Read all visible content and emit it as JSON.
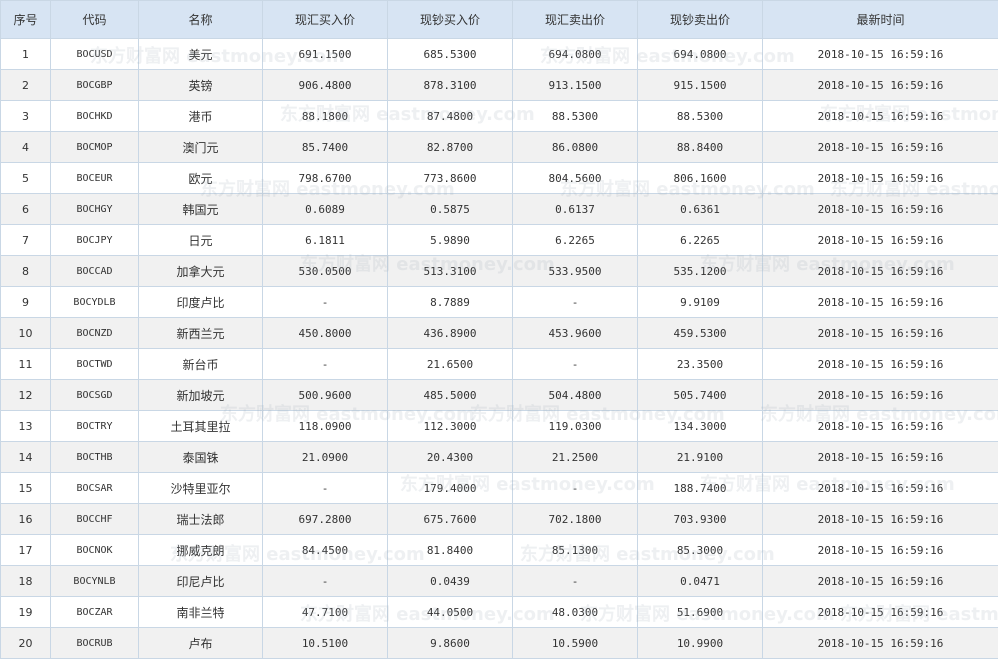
{
  "headers": [
    "序号",
    "代码",
    "名称",
    "现汇买入价",
    "现钞买入价",
    "现汇卖出价",
    "现钞卖出价",
    "最新时间"
  ],
  "rows": [
    [
      "1",
      "BOCUSD",
      "美元",
      "691.1500",
      "685.5300",
      "694.0800",
      "694.0800",
      "2018-10-15 16:59:16"
    ],
    [
      "2",
      "BOCGBP",
      "英镑",
      "906.4800",
      "878.3100",
      "913.1500",
      "915.1500",
      "2018-10-15 16:59:16"
    ],
    [
      "3",
      "BOCHKD",
      "港币",
      "88.1800",
      "87.4800",
      "88.5300",
      "88.5300",
      "2018-10-15 16:59:16"
    ],
    [
      "4",
      "BOCMOP",
      "澳门元",
      "85.7400",
      "82.8700",
      "86.0800",
      "88.8400",
      "2018-10-15 16:59:16"
    ],
    [
      "5",
      "BOCEUR",
      "欧元",
      "798.6700",
      "773.8600",
      "804.5600",
      "806.1600",
      "2018-10-15 16:59:16"
    ],
    [
      "6",
      "BOCHGY",
      "韩国元",
      "0.6089",
      "0.5875",
      "0.6137",
      "0.6361",
      "2018-10-15 16:59:16"
    ],
    [
      "7",
      "BOCJPY",
      "日元",
      "6.1811",
      "5.9890",
      "6.2265",
      "6.2265",
      "2018-10-15 16:59:16"
    ],
    [
      "8",
      "BOCCAD",
      "加拿大元",
      "530.0500",
      "513.3100",
      "533.9500",
      "535.1200",
      "2018-10-15 16:59:16"
    ],
    [
      "9",
      "BOCYDLB",
      "印度卢比",
      "-",
      "8.7889",
      "-",
      "9.9109",
      "2018-10-15 16:59:16"
    ],
    [
      "10",
      "BOCNZD",
      "新西兰元",
      "450.8000",
      "436.8900",
      "453.9600",
      "459.5300",
      "2018-10-15 16:59:16"
    ],
    [
      "11",
      "BOCTWD",
      "新台币",
      "-",
      "21.6500",
      "-",
      "23.3500",
      "2018-10-15 16:59:16"
    ],
    [
      "12",
      "BOCSGD",
      "新加坡元",
      "500.9600",
      "485.5000",
      "504.4800",
      "505.7400",
      "2018-10-15 16:59:16"
    ],
    [
      "13",
      "BOCTRY",
      "土耳其里拉",
      "118.0900",
      "112.3000",
      "119.0300",
      "134.3000",
      "2018-10-15 16:59:16"
    ],
    [
      "14",
      "BOCTHB",
      "泰国铢",
      "21.0900",
      "20.4300",
      "21.2500",
      "21.9100",
      "2018-10-15 16:59:16"
    ],
    [
      "15",
      "BOCSAR",
      "沙特里亚尔",
      "-",
      "179.4000",
      "-",
      "188.7400",
      "2018-10-15 16:59:16"
    ],
    [
      "16",
      "BOCCHF",
      "瑞士法郎",
      "697.2800",
      "675.7600",
      "702.1800",
      "703.9300",
      "2018-10-15 16:59:16"
    ],
    [
      "17",
      "BOCNOK",
      "挪威克朗",
      "84.4500",
      "81.8400",
      "85.1300",
      "85.3000",
      "2018-10-15 16:59:16"
    ],
    [
      "18",
      "BOCYNLB",
      "印尼卢比",
      "-",
      "0.0439",
      "-",
      "0.0471",
      "2018-10-15 16:59:16"
    ],
    [
      "19",
      "BOCZAR",
      "南非兰特",
      "47.7100",
      "44.0500",
      "48.0300",
      "51.6900",
      "2018-10-15 16:59:16"
    ],
    [
      "20",
      "BOCRUB",
      "卢布",
      "10.5100",
      "9.8600",
      "10.5900",
      "10.9900",
      "2018-10-15 16:59:16"
    ]
  ],
  "watermark": {
    "text": "东方财富网 eastmoney.com"
  }
}
